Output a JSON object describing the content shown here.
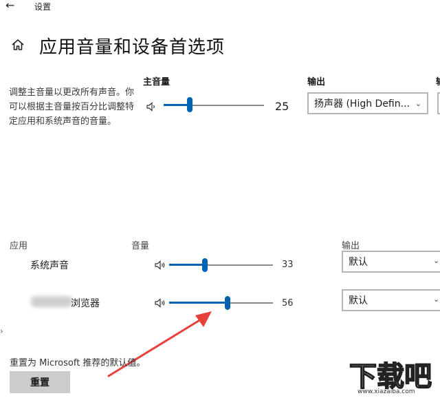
{
  "titlebar": {
    "back_glyph": "←",
    "title": "设置"
  },
  "header": {
    "title": "应用音量和设备首选项",
    "icon": "home-icon"
  },
  "description": "调整主音量以更改所有声音。你可以根据主音量按百分比调整特定应用和系统声音的音量。",
  "master": {
    "label": "主音量",
    "value": "25",
    "level": 0.25,
    "icon": "speaker-icon"
  },
  "output": {
    "label": "输出",
    "selected": "扬声器 (High Defin...",
    "partial_label": "输"
  },
  "apps": {
    "col_app": "应用",
    "col_volume": "音量",
    "col_output": "输出",
    "rows": [
      {
        "name": "系统声音",
        "volume": "33",
        "level": 0.33,
        "output": "默认"
      },
      {
        "name": "浏览器",
        "volume": "56",
        "level": 0.56,
        "output": "默认"
      }
    ]
  },
  "reset": {
    "text": "重置为 Microsoft 推荐的默认值。",
    "button": "重置"
  },
  "watermark": {
    "logo": "下载吧",
    "site": "www.xiazaiba.com"
  },
  "colors": {
    "accent": "#0063b1",
    "annotation_arrow": "#e8403a",
    "button_bg": "#cccccc"
  }
}
